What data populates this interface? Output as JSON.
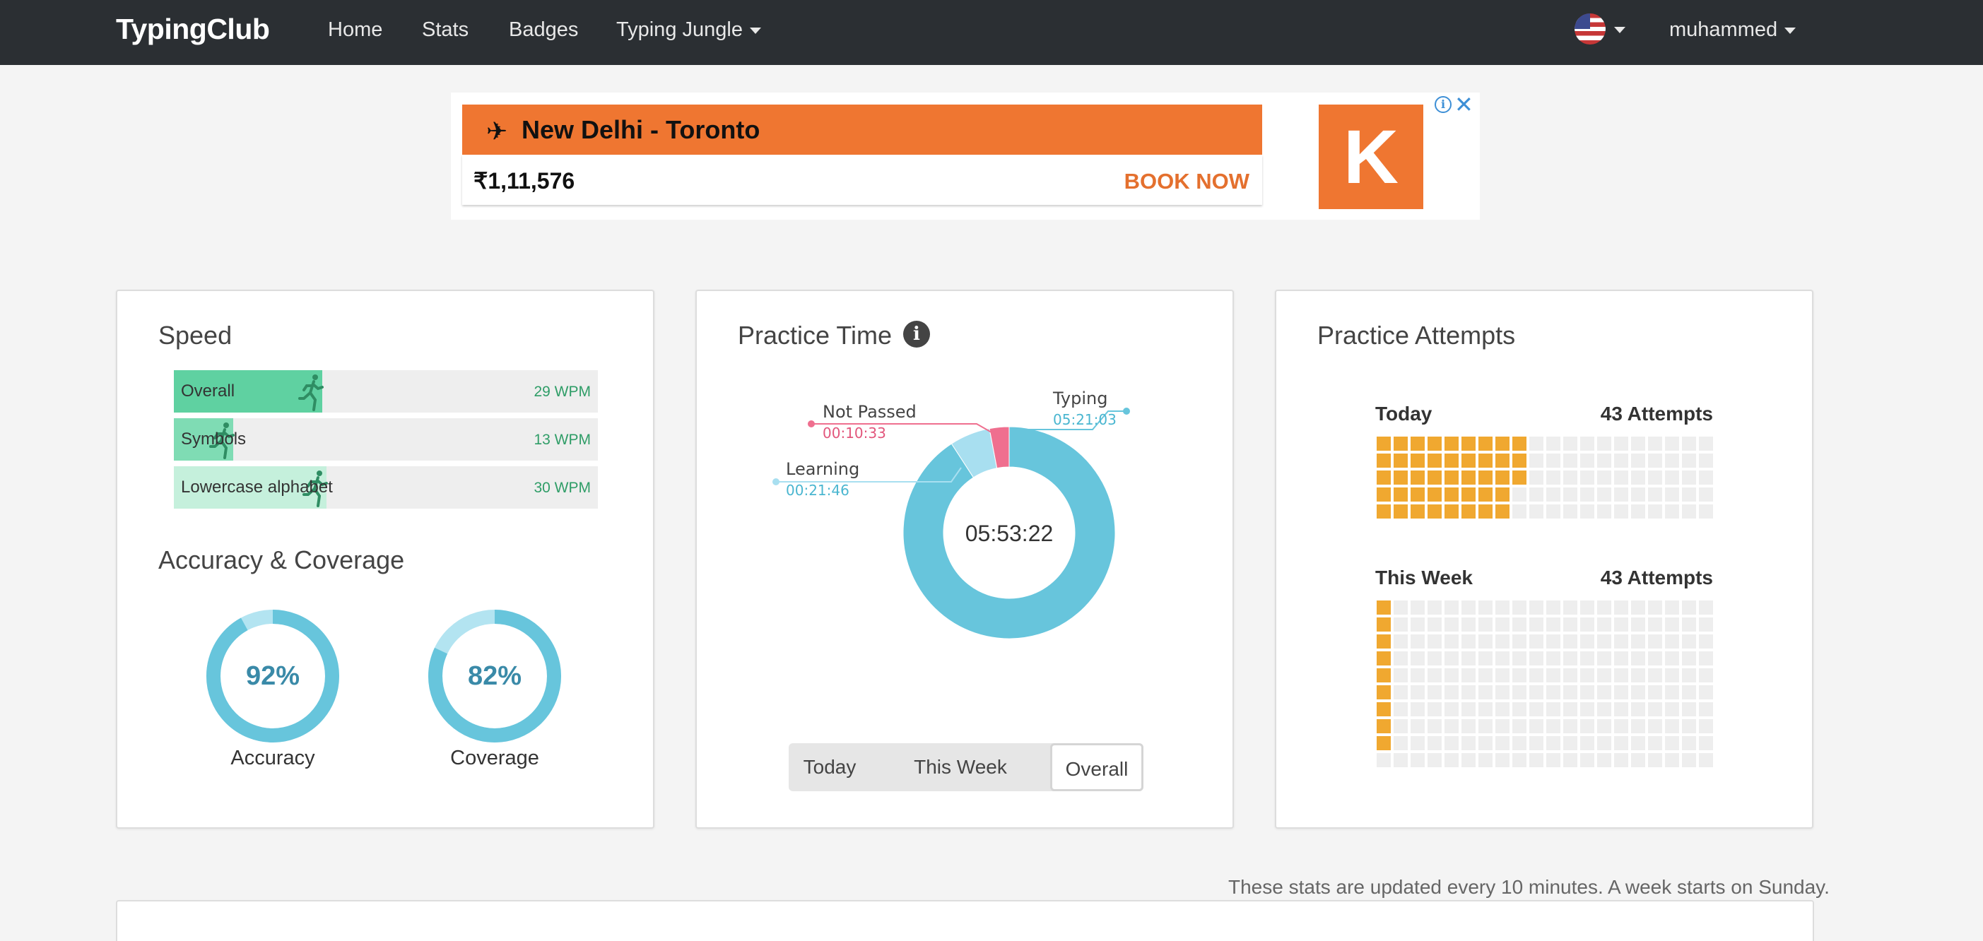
{
  "nav": {
    "brand": "TypingClub",
    "links": [
      "Home",
      "Stats",
      "Badges",
      "Typing Jungle"
    ],
    "user": "muhammed"
  },
  "ad": {
    "route": "New Delhi - Toronto",
    "price": "₹1,11,576",
    "cta": "BOOK NOW",
    "logo_letter": "K",
    "info": "i",
    "close": "✕",
    "plane": "✈"
  },
  "speed": {
    "title": "Speed",
    "bars": [
      {
        "label": "Overall",
        "value": "29 WPM",
        "fill": 0.35,
        "color": "#5fd1a1"
      },
      {
        "label": "Symbols",
        "value": "13 WPM",
        "fill": 0.14,
        "color": "#7fdcb4"
      },
      {
        "label": "Lowercase alphabet",
        "value": "30 WPM",
        "fill": 0.36,
        "color": "#c5f0dc"
      }
    ]
  },
  "accuracy": {
    "title": "Accuracy & Coverage",
    "items": [
      {
        "label": "Accuracy",
        "value": "92%",
        "percent": 92
      },
      {
        "label": "Coverage",
        "value": "82%",
        "percent": 82
      }
    ]
  },
  "practice_time": {
    "title": "Practice Time",
    "total": "05:53:22",
    "info": "i",
    "buttons": [
      "Today",
      "This Week",
      "Overall"
    ],
    "active": "Overall",
    "segments": [
      {
        "label": "Typing",
        "time": "05:21:03",
        "seconds": 19263,
        "color": "#67c5dc"
      },
      {
        "label": "Learning",
        "time": "00:21:46",
        "seconds": 1306,
        "color": "#a8dff0"
      },
      {
        "label": "Not Passed",
        "time": "00:10:33",
        "seconds": 633,
        "color": "#ef6f8f"
      }
    ]
  },
  "attempts": {
    "title": "Practice Attempts",
    "today": {
      "label": "Today",
      "count": "43 Attempts",
      "filled": 43
    },
    "week": {
      "label": "This Week",
      "count": "43 Attempts",
      "filled": 9
    }
  },
  "footer_note": "These stats are updated every 10 minutes. A week starts on Sunday.",
  "colors": {
    "accent": "#67c5dc",
    "attempt": "#f0a830",
    "empty": "#eeeeee"
  }
}
